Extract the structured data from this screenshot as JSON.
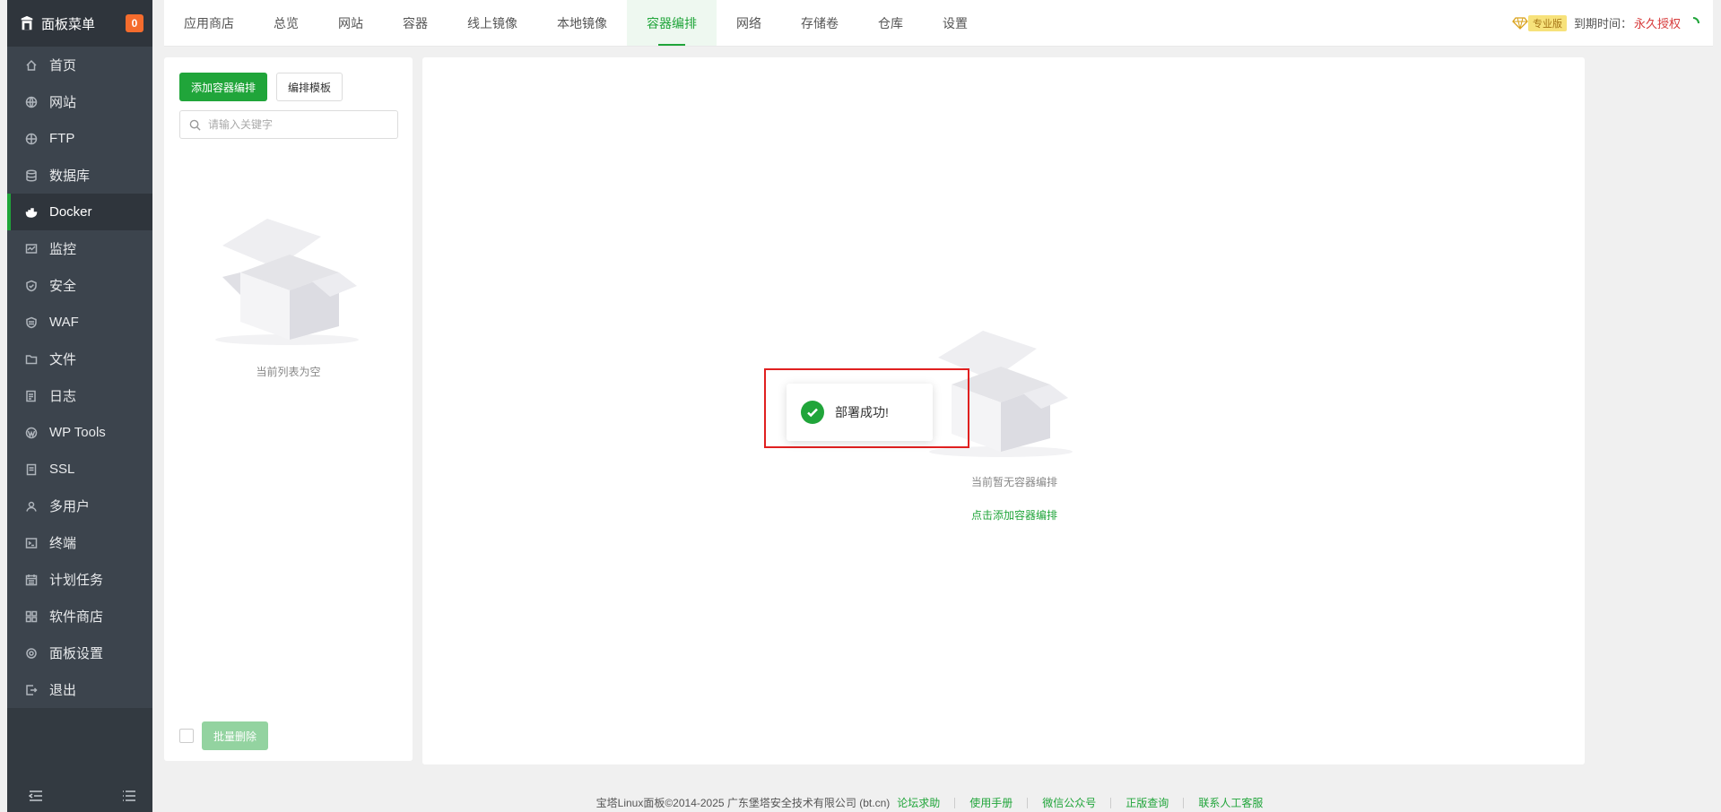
{
  "sidebar": {
    "title": "面板菜单",
    "badge": "0",
    "items": [
      {
        "label": "首页",
        "icon": "home-icon"
      },
      {
        "label": "网站",
        "icon": "globe-icon"
      },
      {
        "label": "FTP",
        "icon": "ftp-icon"
      },
      {
        "label": "数据库",
        "icon": "database-icon"
      },
      {
        "label": "Docker",
        "icon": "docker-icon",
        "active": true
      },
      {
        "label": "监控",
        "icon": "monitor-icon"
      },
      {
        "label": "安全",
        "icon": "shield-icon"
      },
      {
        "label": "WAF",
        "icon": "waf-icon"
      },
      {
        "label": "文件",
        "icon": "folder-icon"
      },
      {
        "label": "日志",
        "icon": "log-icon"
      },
      {
        "label": "WP Tools",
        "icon": "wordpress-icon"
      },
      {
        "label": "SSL",
        "icon": "ssl-icon"
      },
      {
        "label": "多用户",
        "icon": "users-icon"
      },
      {
        "label": "终端",
        "icon": "terminal-icon"
      },
      {
        "label": "计划任务",
        "icon": "calendar-icon"
      },
      {
        "label": "软件商店",
        "icon": "store-icon"
      },
      {
        "label": "面板设置",
        "icon": "gear-icon"
      },
      {
        "label": "退出",
        "icon": "logout-icon"
      }
    ]
  },
  "topnav": {
    "tabs": [
      {
        "label": "应用商店"
      },
      {
        "label": "总览"
      },
      {
        "label": "网站"
      },
      {
        "label": "容器"
      },
      {
        "label": "线上镜像"
      },
      {
        "label": "本地镜像"
      },
      {
        "label": "容器编排",
        "active": true
      },
      {
        "label": "网络"
      },
      {
        "label": "存储卷"
      },
      {
        "label": "仓库"
      },
      {
        "label": "设置"
      }
    ],
    "pro_label": "专业版",
    "expire_label": "到期时间：",
    "expire_value": "永久授权"
  },
  "left_panel": {
    "add_button": "添加容器编排",
    "template_button": "编排模板",
    "search_placeholder": "请输入关键字",
    "empty_text": "当前列表为空",
    "batch_delete": "批量删除"
  },
  "main_panel": {
    "empty_text": "当前暂无容器编排",
    "add_link": "点击添加容器编排"
  },
  "toast": {
    "message": "部署成功!"
  },
  "footer": {
    "copyright": "宝塔Linux面板©2014-2025 广东堡塔安全技术有限公司 (bt.cn)",
    "links": [
      "论坛求助",
      "使用手册",
      "微信公众号",
      "正版查询",
      "联系人工客服"
    ]
  },
  "colors": {
    "accent": "#20a53a",
    "sidebar_bg": "#3c444d",
    "highlight": "#e02020",
    "expire": "#d73b3b"
  }
}
